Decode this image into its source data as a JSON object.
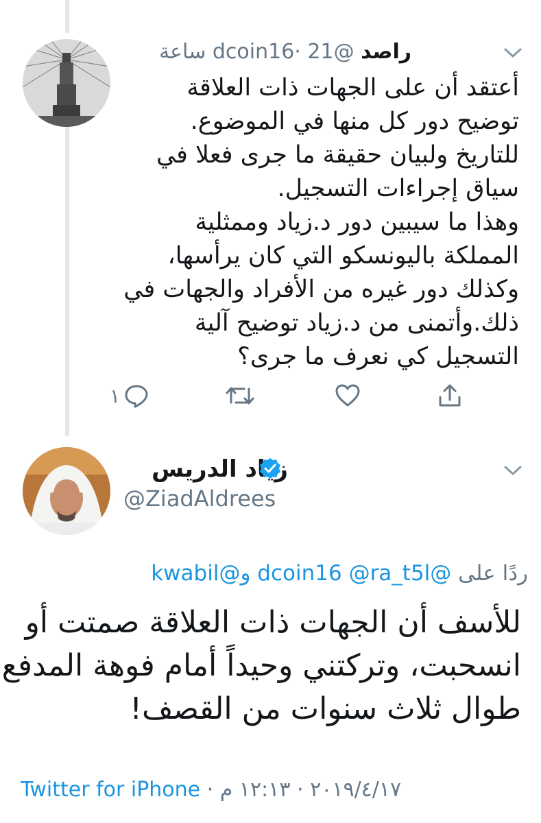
{
  "tweet1": {
    "author_name": "راصد",
    "handle": "@dcoin16",
    "separator": "·",
    "time": "21 ساعة",
    "body_lines": [
      "أعتقد أن على الجهات ذات العلاقة",
      "توضيح دور كل منها في الموضوع.",
      "للتاريخ ولبيان حقيقة ما جرى فعلا في",
      "سياق إجراءات التسجيل.",
      "وهذا ما سيبين دور د.زياد وممثلية",
      "المملكة باليونسكو التي كان يرأسها،",
      "وكذلك دور غيره من الأفراد والجهات في",
      "ذلك.وأتمنى من د.زياد توضيح آلية",
      "التسجيل كي نعرف ما جرى؟"
    ],
    "reply_count": "١",
    "icons": {
      "reply": "reply-icon",
      "retweet": "retweet-icon",
      "like": "heart-icon",
      "share": "share-icon",
      "menu": "chevron-down-icon"
    }
  },
  "tweet2": {
    "author_name": "زياد الدريس",
    "handle": "@ZiadAldrees",
    "verified_icon": "verified-badge-icon",
    "reply_prefix": "ردًا على",
    "reply_mentions": [
      "@dcoin16",
      "@ra_t5l",
      "@kwabil"
    ],
    "reply_conjunction": "و",
    "body_lines": [
      "للأسف أن الجهات ذات العلاقة صمتت أو",
      "انسحبت، وتركتني وحيداً أمام فوهة المدفع",
      "طوال ثلاث سنوات من القصف!"
    ],
    "time": "١٢:١٣ م",
    "date": "٢٠١٩/٤/١٧",
    "separator": "·",
    "source": "Twitter for iPhone"
  },
  "colors": {
    "link": "#1b95e0",
    "secondary_text": "#657786",
    "primary_text": "#14171a",
    "thread_line": "#e1e8ed",
    "verified": "#1da1f2"
  }
}
